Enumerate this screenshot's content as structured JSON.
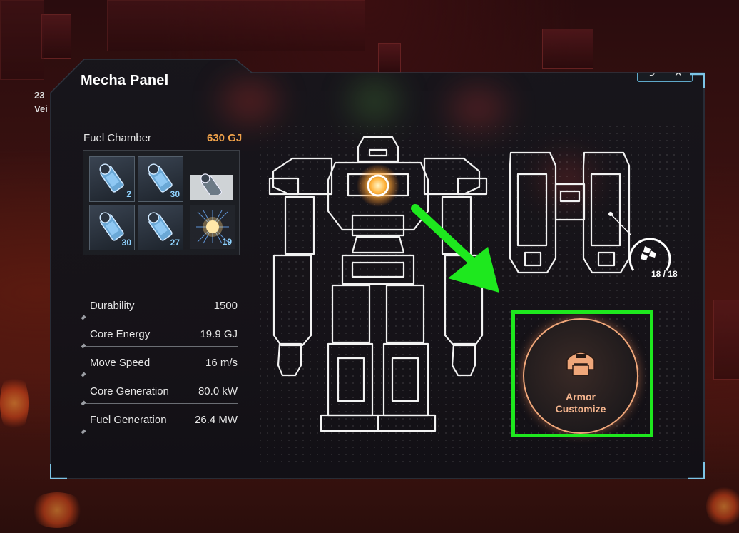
{
  "hud": {
    "line1": "23",
    "line2": "Vei"
  },
  "panel": {
    "title": "Mecha Panel",
    "controls": {
      "undo_icon": "undo-icon",
      "close_icon": "close-icon",
      "undo": "⮌",
      "close": "✕"
    }
  },
  "fuel": {
    "label": "Fuel Chamber",
    "value": "630 GJ",
    "slots": [
      {
        "count": "2",
        "icon": "fuel-canister-icon"
      },
      {
        "count": "30",
        "icon": "fuel-canister-icon"
      },
      {
        "count": "",
        "icon": "fuel-canister-ghost-icon"
      },
      {
        "count": "30",
        "icon": "fuel-canister-icon"
      },
      {
        "count": "27",
        "icon": "fuel-canister-icon"
      },
      {
        "count": "19",
        "icon": "antimatter-icon"
      }
    ]
  },
  "stats": [
    {
      "label": "Durability",
      "value": "1500"
    },
    {
      "label": "Core Energy",
      "value": "19.9 GJ"
    },
    {
      "label": "Move Speed",
      "value": "16 m/s"
    },
    {
      "label": "Core Generation",
      "value": "80.0 kW"
    },
    {
      "label": "Fuel Generation",
      "value": "26.4 MW"
    }
  ],
  "drones": {
    "count": "18 / 18",
    "icon": "drone-icon"
  },
  "armor": {
    "line1": "Armor",
    "line2": "Customize",
    "icon": "helmet-icon"
  },
  "colors": {
    "accent": "#f0a24a",
    "highlight": "#1ee81e",
    "frame": "#5fa8c9",
    "armor": "#f5b58e"
  }
}
